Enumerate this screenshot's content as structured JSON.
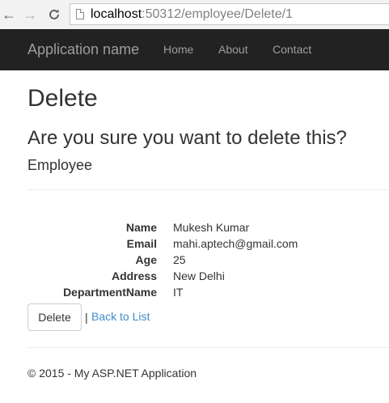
{
  "browser": {
    "back_icon": "arrow-left-icon",
    "forward_icon": "arrow-right-icon",
    "reload_icon": "reload-icon",
    "url_host": "localhost",
    "url_rest": ":50312/employee/Delete/1"
  },
  "navbar": {
    "brand": "Application name",
    "links": [
      "Home",
      "About",
      "Contact"
    ]
  },
  "page": {
    "title": "Delete",
    "confirm": "Are you sure you want to delete this?",
    "entity": "Employee"
  },
  "details": [
    {
      "label": "Name",
      "value": "Mukesh Kumar"
    },
    {
      "label": "Email",
      "value": "mahi.aptech@gmail.com"
    },
    {
      "label": "Age",
      "value": "25"
    },
    {
      "label": "Address",
      "value": "New Delhi"
    },
    {
      "label": "DepartmentName",
      "value": "IT"
    }
  ],
  "actions": {
    "delete_label": "Delete",
    "separator": "|",
    "back_label": "Back to List"
  },
  "footer": "© 2015 - My ASP.NET Application",
  "colors": {
    "navbar_bg": "#222222",
    "nav_text": "#9d9d9d",
    "link": "#428bca"
  }
}
